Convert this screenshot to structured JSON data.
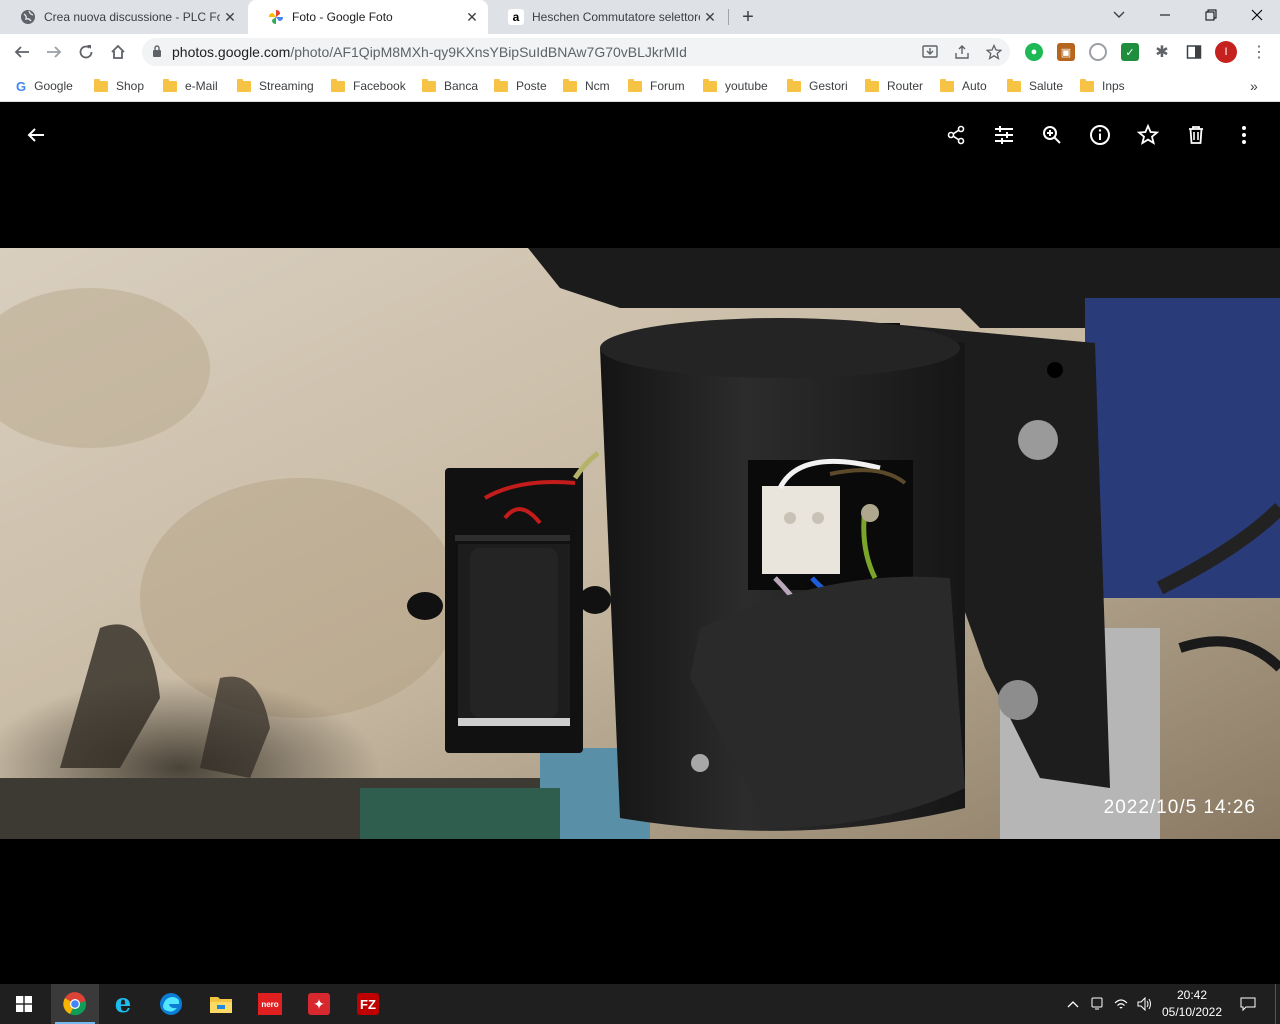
{
  "browser": {
    "tabs": [
      {
        "title": "Crea nuova discussione - PLC Forum",
        "active": false
      },
      {
        "title": "Foto - Google Foto",
        "active": true
      },
      {
        "title": "Heschen Commutatore selettore",
        "active": false
      }
    ],
    "new_tab": "+",
    "address": {
      "host": "photos.google.com",
      "path": "/photo/AF1QipM8MXh-qy9KXnsYBipSuIdBNAw7G70vBLJkrMId"
    },
    "profile_initial": "I",
    "bookmarks": [
      "Google",
      "Shop",
      "e-Mail",
      "Streaming",
      "Facebook",
      "Banca",
      "Poste",
      "Ncm",
      "Forum",
      "youtube",
      "Gestori",
      "Router",
      "Auto",
      "Salute",
      "Inps"
    ],
    "bookmarks_overflow": "»"
  },
  "viewer": {
    "photo_timestamp": "2022/10/5  14:26",
    "icons": [
      "back-arrow-icon",
      "share-icon",
      "edit-icon",
      "zoom-icon",
      "info-icon",
      "favorite-star-icon",
      "delete-icon",
      "more-icon"
    ]
  },
  "taskbar": {
    "apps": [
      "windows-start",
      "chrome",
      "internet-explorer",
      "edge",
      "file-explorer",
      "nero",
      "acrobat",
      "filezilla"
    ],
    "time": "20:42",
    "date": "05/10/2022"
  }
}
